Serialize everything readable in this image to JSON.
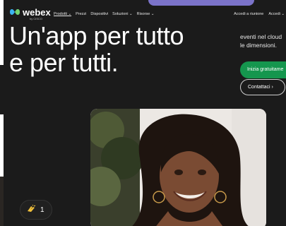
{
  "brand": {
    "name": "webex",
    "by": "by CISCO"
  },
  "nav": {
    "items": [
      "Prodotti",
      "Prezzi",
      "Dispositivi",
      "Soluzioni",
      "Risorse"
    ],
    "right": [
      "Accedi a riunione",
      "Accedi"
    ]
  },
  "hero": {
    "headline_line1": "Un'app per tutto",
    "headline_line2": "e per tutti.",
    "side_text_line1": "eventi nel cloud",
    "side_text_line2": "le dimensioni.",
    "cta_primary": "Inizia gratuitame",
    "cta_secondary": "Contattaci"
  },
  "reaction": {
    "icon": "clap-icon",
    "count": "1"
  },
  "colors": {
    "background": "#1b1b1b",
    "accent_green": "#15964e",
    "deco_purple": "#7b73c9"
  }
}
